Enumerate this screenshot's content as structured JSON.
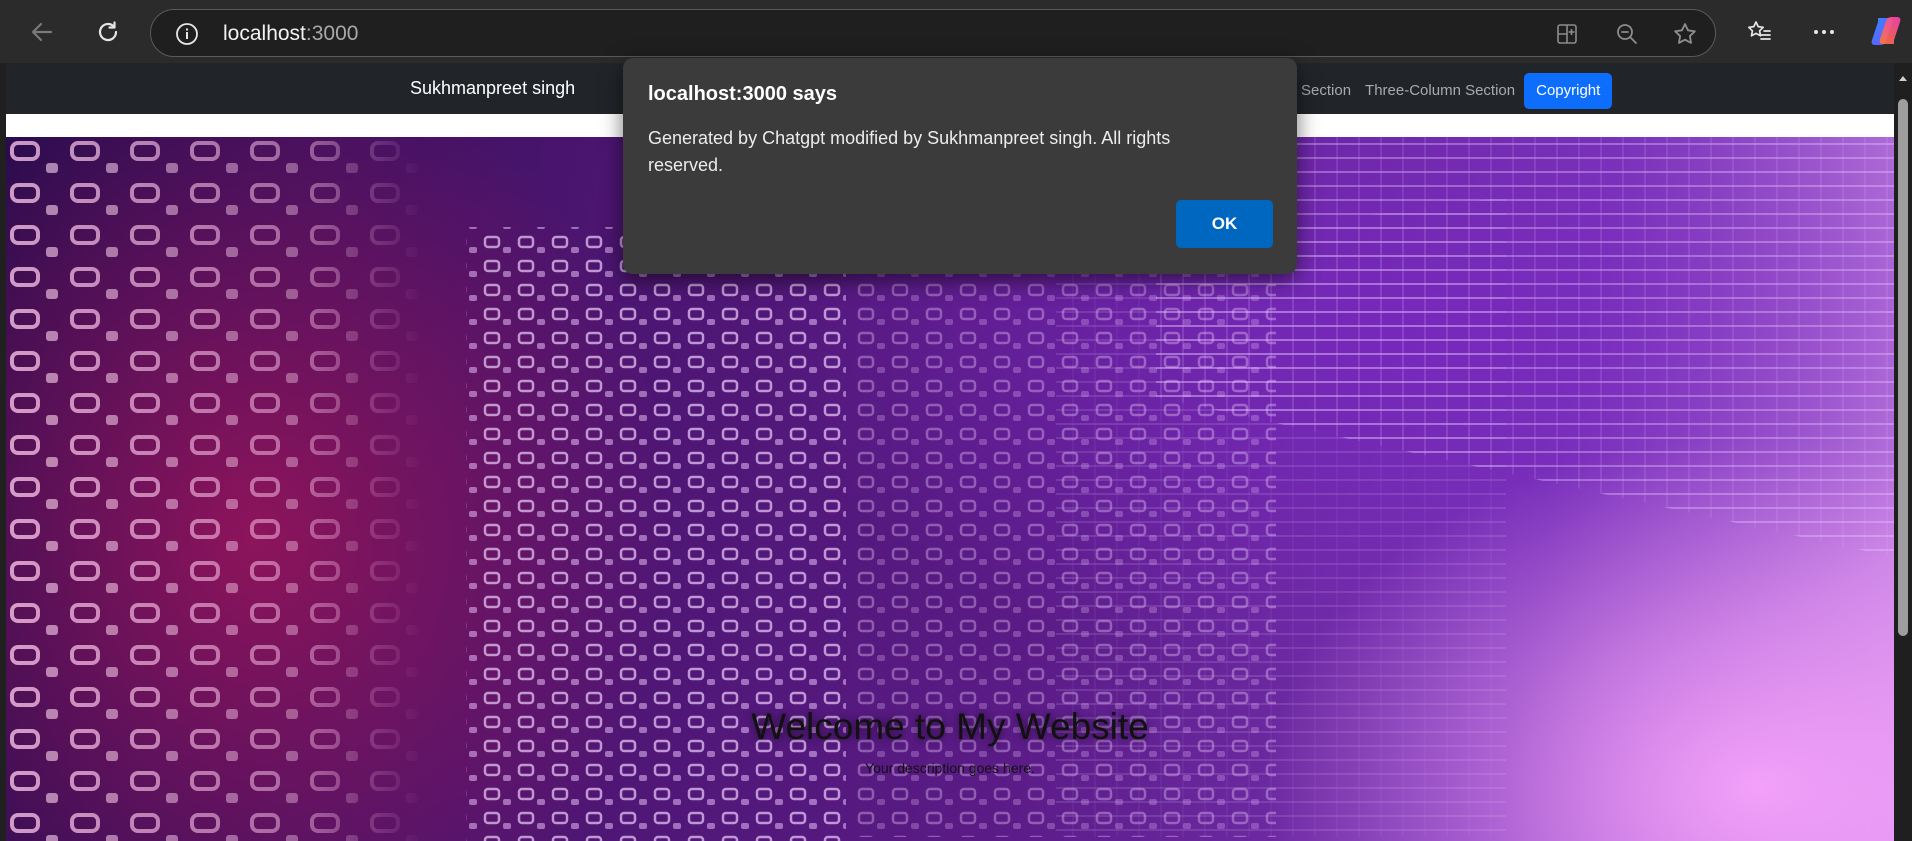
{
  "browser": {
    "url_host": "localhost",
    "url_port": ":3000",
    "icons": {
      "back": "back-arrow-icon",
      "refresh": "refresh-icon",
      "info": "site-info-icon",
      "split": "split-screen-icon",
      "zoom": "zoom-out-icon",
      "favorite": "favorite-star-icon",
      "favorites_list": "favorites-list-icon",
      "more": "more-options-icon",
      "copilot": "copilot-icon"
    }
  },
  "page": {
    "navbar": {
      "brand": "Sukhmanpreet singh",
      "links": [
        {
          "label": "Section"
        },
        {
          "label": "Three-Column Section"
        },
        {
          "label": "Copyright",
          "active": true
        }
      ]
    },
    "hero": {
      "title": "Welcome to My Website",
      "description": "Your description goes here."
    }
  },
  "dialog": {
    "title": "localhost:3000 says",
    "message": "Generated by Chatgpt modified by Sukhmanpreet singh. All rights reserved.",
    "ok_label": "OK"
  },
  "colors": {
    "nav_bg": "#212529",
    "active_link": "#0d6efd",
    "dialog_bg": "#3b3b3b",
    "ok_button": "#0067c0"
  }
}
